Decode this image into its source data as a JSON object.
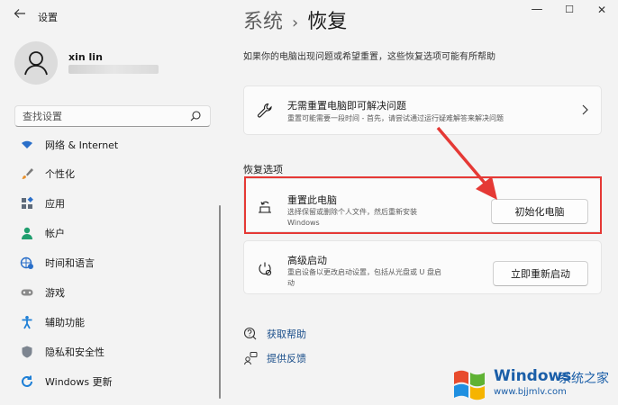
{
  "window": {
    "title": "设置",
    "controls": {
      "minimize": "—",
      "maximize": "☐",
      "close": "✕"
    }
  },
  "user": {
    "name": "xin lin"
  },
  "search": {
    "placeholder": "查找设置"
  },
  "nav": {
    "items": [
      {
        "label": "网络 & Internet",
        "icon": "network-icon"
      },
      {
        "label": "个性化",
        "icon": "brush-icon"
      },
      {
        "label": "应用",
        "icon": "apps-icon"
      },
      {
        "label": "帐户",
        "icon": "account-icon"
      },
      {
        "label": "时间和语言",
        "icon": "globe-clock-icon"
      },
      {
        "label": "游戏",
        "icon": "gamepad-icon"
      },
      {
        "label": "辅助功能",
        "icon": "accessibility-icon"
      },
      {
        "label": "隐私和安全性",
        "icon": "shield-icon"
      },
      {
        "label": "Windows 更新",
        "icon": "update-icon"
      }
    ]
  },
  "main": {
    "breadcrumb": {
      "parent": "系统",
      "separator": "›",
      "current": "恢复"
    },
    "intro": "如果你的电脑出现问题或希望重置，这些恢复选项可能有所帮助",
    "fix_card": {
      "title": "无需重置电脑即可解决问题",
      "desc": "重置可能需要一段时间 - 首先，请尝试通过运行疑难解答来解决问题"
    },
    "section_title": "恢复选项",
    "reset_card": {
      "title": "重置此电脑",
      "desc_line1": "选择保留或删除个人文件，然后重新安装",
      "desc_line2": "Windows",
      "button": "初始化电脑"
    },
    "advanced_card": {
      "title": "高级启动",
      "desc_line1": "重启设备以更改启动设置，包括从光盘或 U 盘启",
      "desc_line2": "动",
      "button": "立即重新启动"
    },
    "links": [
      {
        "label": "获取帮助",
        "icon": "help-icon"
      },
      {
        "label": "提供反馈",
        "icon": "feedback-icon"
      }
    ]
  },
  "watermark": {
    "brand": "Windows",
    "brand_cn": "系统之家",
    "url": "www.bjjmlv.com"
  },
  "colors": {
    "accent": "#0067c0",
    "highlight": "#e53935",
    "link": "#1a4e8a"
  }
}
